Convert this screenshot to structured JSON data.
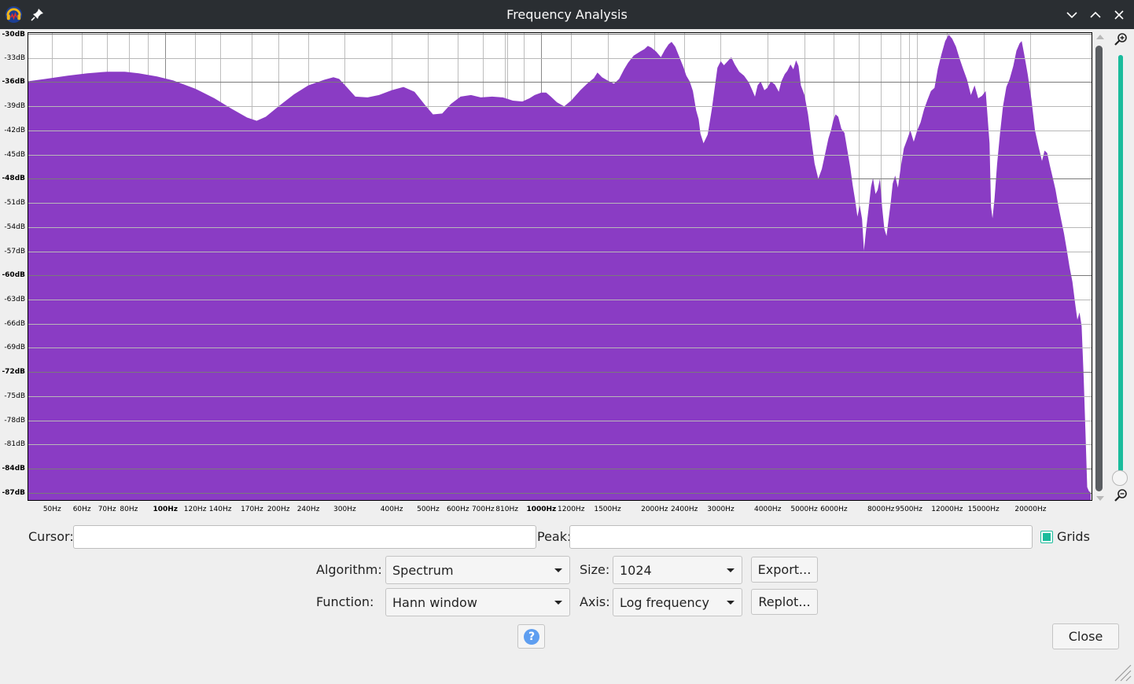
{
  "window": {
    "title": "Frequency Analysis",
    "icons": [
      "audacity-app-icon",
      "pin-icon",
      "minimize-icon",
      "maximize-icon",
      "close-icon"
    ]
  },
  "plot": {
    "fill_color": "#8a3cc4",
    "y_ticks": [
      {
        "label": "-30dB",
        "value": -30,
        "major": true
      },
      {
        "label": "-33dB",
        "value": -33,
        "major": false
      },
      {
        "label": "-36dB",
        "value": -36,
        "major": true
      },
      {
        "label": "-39dB",
        "value": -39,
        "major": false
      },
      {
        "label": "-42dB",
        "value": -42,
        "major": false
      },
      {
        "label": "-45dB",
        "value": -45,
        "major": false
      },
      {
        "label": "-48dB",
        "value": -48,
        "major": true
      },
      {
        "label": "-51dB",
        "value": -51,
        "major": false
      },
      {
        "label": "-54dB",
        "value": -54,
        "major": false
      },
      {
        "label": "-57dB",
        "value": -57,
        "major": false
      },
      {
        "label": "-60dB",
        "value": -60,
        "major": true
      },
      {
        "label": "-63dB",
        "value": -63,
        "major": false
      },
      {
        "label": "-66dB",
        "value": -66,
        "major": false
      },
      {
        "label": "-69dB",
        "value": -69,
        "major": false
      },
      {
        "label": "-72dB",
        "value": -72,
        "major": true
      },
      {
        "label": "-75dB",
        "value": -75,
        "major": false
      },
      {
        "label": "-78dB",
        "value": -78,
        "major": false
      },
      {
        "label": "-81dB",
        "value": -81,
        "major": false
      },
      {
        "label": "-84dB",
        "value": -84,
        "major": true
      },
      {
        "label": "-87dB",
        "value": -87,
        "major": true
      }
    ],
    "x_ticks": [
      {
        "label": "50Hz",
        "value": 50,
        "major": false
      },
      {
        "label": "60Hz",
        "value": 60,
        "major": false
      },
      {
        "label": "70Hz",
        "value": 70,
        "major": false
      },
      {
        "label": "80Hz",
        "value": 80,
        "major": false
      },
      {
        "label": "100Hz",
        "value": 100,
        "major": true
      },
      {
        "label": "120Hz",
        "value": 120,
        "major": false
      },
      {
        "label": "140Hz",
        "value": 140,
        "major": false
      },
      {
        "label": "170Hz",
        "value": 170,
        "major": false
      },
      {
        "label": "200Hz",
        "value": 200,
        "major": false
      },
      {
        "label": "240Hz",
        "value": 240,
        "major": false
      },
      {
        "label": "300Hz",
        "value": 300,
        "major": false
      },
      {
        "label": "400Hz",
        "value": 400,
        "major": false
      },
      {
        "label": "500Hz",
        "value": 500,
        "major": false
      },
      {
        "label": "600Hz",
        "value": 600,
        "major": false
      },
      {
        "label": "700Hz",
        "value": 700,
        "major": false
      },
      {
        "label": "810Hz",
        "value": 810,
        "major": false
      },
      {
        "label": "1000Hz",
        "value": 1000,
        "major": true
      },
      {
        "label": "1200Hz",
        "value": 1200,
        "major": false
      },
      {
        "label": "1500Hz",
        "value": 1500,
        "major": false
      },
      {
        "label": "2000Hz",
        "value": 2000,
        "major": false
      },
      {
        "label": "2400Hz",
        "value": 2400,
        "major": false
      },
      {
        "label": "3000Hz",
        "value": 3000,
        "major": false
      },
      {
        "label": "4000Hz",
        "value": 4000,
        "major": false
      },
      {
        "label": "5000Hz",
        "value": 5000,
        "major": false
      },
      {
        "label": "6000Hz",
        "value": 6000,
        "major": false
      },
      {
        "label": "8000Hz",
        "value": 8000,
        "major": false
      },
      {
        "label": "9500Hz",
        "value": 9500,
        "major": false
      },
      {
        "label": "12000Hz",
        "value": 12000,
        "major": false
      },
      {
        "label": "15000Hz",
        "value": 15000,
        "major": false
      },
      {
        "label": "20000Hz",
        "value": 20000,
        "major": false
      }
    ],
    "spectrum": [
      [
        43,
        -35.9
      ],
      [
        48,
        -35.6
      ],
      [
        55,
        -35.2
      ],
      [
        62,
        -34.9
      ],
      [
        70,
        -34.7
      ],
      [
        78,
        -34.7
      ],
      [
        85,
        -34.9
      ],
      [
        95,
        -35.3
      ],
      [
        105,
        -35.8
      ],
      [
        120,
        -36.8
      ],
      [
        135,
        -38.0
      ],
      [
        150,
        -39.3
      ],
      [
        165,
        -40.4
      ],
      [
        175,
        -40.8
      ],
      [
        185,
        -40.3
      ],
      [
        200,
        -39.0
      ],
      [
        220,
        -37.5
      ],
      [
        240,
        -36.4
      ],
      [
        265,
        -35.7
      ],
      [
        280,
        -35.4
      ],
      [
        290,
        -35.6
      ],
      [
        305,
        -36.7
      ],
      [
        320,
        -37.8
      ],
      [
        345,
        -37.9
      ],
      [
        370,
        -37.6
      ],
      [
        400,
        -37.0
      ],
      [
        430,
        -36.6
      ],
      [
        460,
        -37.2
      ],
      [
        490,
        -38.8
      ],
      [
        515,
        -40.0
      ],
      [
        545,
        -39.9
      ],
      [
        575,
        -38.7
      ],
      [
        610,
        -37.8
      ],
      [
        650,
        -37.6
      ],
      [
        690,
        -37.9
      ],
      [
        740,
        -37.8
      ],
      [
        790,
        -37.9
      ],
      [
        840,
        -38.3
      ],
      [
        890,
        -38.4
      ],
      [
        930,
        -38.0
      ],
      [
        960,
        -37.6
      ],
      [
        1000,
        -37.3
      ],
      [
        1030,
        -37.3
      ],
      [
        1060,
        -37.8
      ],
      [
        1100,
        -38.5
      ],
      [
        1150,
        -39.0
      ],
      [
        1200,
        -38.3
      ],
      [
        1270,
        -37.0
      ],
      [
        1330,
        -36.1
      ],
      [
        1380,
        -35.5
      ],
      [
        1410,
        -34.8
      ],
      [
        1450,
        -35.4
      ],
      [
        1500,
        -35.8
      ],
      [
        1560,
        -36.2
      ],
      [
        1610,
        -35.6
      ],
      [
        1660,
        -34.4
      ],
      [
        1700,
        -33.6
      ],
      [
        1760,
        -32.7
      ],
      [
        1830,
        -32.2
      ],
      [
        1880,
        -31.9
      ],
      [
        1920,
        -31.5
      ],
      [
        1960,
        -31.7
      ],
      [
        2020,
        -32.2
      ],
      [
        2080,
        -32.9
      ],
      [
        2130,
        -32.0
      ],
      [
        2180,
        -31.3
      ],
      [
        2220,
        -31.0
      ],
      [
        2270,
        -31.6
      ],
      [
        2330,
        -32.9
      ],
      [
        2390,
        -34.2
      ],
      [
        2430,
        -35.2
      ],
      [
        2480,
        -35.9
      ],
      [
        2530,
        -37.1
      ],
      [
        2580,
        -39.5
      ],
      [
        2620,
        -40.6
      ],
      [
        2650,
        -42.4
      ],
      [
        2700,
        -43.6
      ],
      [
        2770,
        -42.5
      ],
      [
        2840,
        -39.4
      ],
      [
        2890,
        -36.8
      ],
      [
        2940,
        -34.2
      ],
      [
        3000,
        -33.4
      ],
      [
        3060,
        -33.9
      ],
      [
        3130,
        -33.4
      ],
      [
        3200,
        -32.9
      ],
      [
        3270,
        -33.8
      ],
      [
        3360,
        -34.7
      ],
      [
        3460,
        -35.2
      ],
      [
        3560,
        -36.0
      ],
      [
        3640,
        -37.0
      ],
      [
        3700,
        -37.8
      ],
      [
        3760,
        -36.4
      ],
      [
        3830,
        -35.9
      ],
      [
        3920,
        -37.0
      ],
      [
        3990,
        -36.7
      ],
      [
        4080,
        -35.9
      ],
      [
        4180,
        -36.3
      ],
      [
        4280,
        -37.2
      ],
      [
        4350,
        -35.9
      ],
      [
        4440,
        -35.0
      ],
      [
        4510,
        -34.6
      ],
      [
        4600,
        -33.8
      ],
      [
        4680,
        -34.4
      ],
      [
        4760,
        -33.3
      ],
      [
        4830,
        -34.0
      ],
      [
        4900,
        -36.4
      ],
      [
        5010,
        -37.6
      ],
      [
        5120,
        -40.0
      ],
      [
        5230,
        -43.3
      ],
      [
        5330,
        -46.1
      ],
      [
        5450,
        -48.0
      ],
      [
        5570,
        -46.8
      ],
      [
        5680,
        -45.0
      ],
      [
        5800,
        -43.0
      ],
      [
        5900,
        -41.9
      ],
      [
        5980,
        -40.7
      ],
      [
        6060,
        -40.0
      ],
      [
        6160,
        -40.3
      ],
      [
        6280,
        -41.8
      ],
      [
        6400,
        -42.3
      ],
      [
        6510,
        -44.4
      ],
      [
        6630,
        -46.6
      ],
      [
        6730,
        -48.8
      ],
      [
        6830,
        -50.6
      ],
      [
        6930,
        -52.7
      ],
      [
        7030,
        -51.3
      ],
      [
        7130,
        -53.0
      ],
      [
        7210,
        -56.9
      ],
      [
        7320,
        -54.0
      ],
      [
        7420,
        -51.7
      ],
      [
        7530,
        -49.0
      ],
      [
        7620,
        -47.9
      ],
      [
        7740,
        -49.9
      ],
      [
        7840,
        -49.4
      ],
      [
        7950,
        -48.0
      ],
      [
        8060,
        -51.5
      ],
      [
        8170,
        -54.2
      ],
      [
        8280,
        -55.1
      ],
      [
        8390,
        -53.0
      ],
      [
        8500,
        -50.9
      ],
      [
        8600,
        -48.6
      ],
      [
        8730,
        -47.6
      ],
      [
        8880,
        -49.1
      ],
      [
        9040,
        -46.5
      ],
      [
        9210,
        -44.2
      ],
      [
        9400,
        -43.1
      ],
      [
        9580,
        -42.0
      ],
      [
        9780,
        -43.4
      ],
      [
        9990,
        -42.0
      ],
      [
        10200,
        -41.0
      ],
      [
        10420,
        -39.4
      ],
      [
        10640,
        -38.2
      ],
      [
        10870,
        -37.1
      ],
      [
        11110,
        -36.7
      ],
      [
        11340,
        -34.3
      ],
      [
        11600,
        -32.5
      ],
      [
        11860,
        -30.9
      ],
      [
        12120,
        -30.1
      ],
      [
        12380,
        -30.6
      ],
      [
        12670,
        -31.6
      ],
      [
        12960,
        -33.1
      ],
      [
        13250,
        -34.4
      ],
      [
        13560,
        -35.7
      ],
      [
        13880,
        -37.6
      ],
      [
        14200,
        -36.4
      ],
      [
        14520,
        -38.0
      ],
      [
        14860,
        -37.7
      ],
      [
        15200,
        -37.1
      ],
      [
        15560,
        -43.6
      ],
      [
        15700,
        -51.5
      ],
      [
        15850,
        -52.9
      ],
      [
        16050,
        -50.4
      ],
      [
        16300,
        -46.2
      ],
      [
        16600,
        -42.3
      ],
      [
        16900,
        -39.0
      ],
      [
        17250,
        -36.6
      ],
      [
        17600,
        -35.6
      ],
      [
        18000,
        -34.0
      ],
      [
        18350,
        -32.1
      ],
      [
        18700,
        -31.2
      ],
      [
        18950,
        -30.9
      ],
      [
        19250,
        -32.6
      ],
      [
        19650,
        -35.0
      ],
      [
        20100,
        -38.1
      ],
      [
        20550,
        -42.0
      ],
      [
        21000,
        -44.0
      ],
      [
        21450,
        -45.8
      ],
      [
        21800,
        -44.5
      ],
      [
        22150,
        -44.8
      ],
      [
        22500,
        -46.3
      ],
      [
        22900,
        -47.8
      ],
      [
        23300,
        -49.3
      ],
      [
        23700,
        -51.3
      ],
      [
        24150,
        -53.2
      ],
      [
        24550,
        -54.8
      ],
      [
        24950,
        -56.7
      ],
      [
        25400,
        -59.0
      ],
      [
        25850,
        -60.8
      ],
      [
        26300,
        -63.6
      ],
      [
        26650,
        -65.5
      ],
      [
        27000,
        -64.6
      ],
      [
        27350,
        -66.3
      ],
      [
        27700,
        -72.7
      ],
      [
        28000,
        -79.5
      ],
      [
        28300,
        -86.3
      ],
      [
        28600,
        -86.8
      ],
      [
        28900,
        -87.0
      ]
    ]
  },
  "controls": {
    "cursor_label": "Cursor:",
    "cursor_value": "",
    "peak_label": "Peak:",
    "peak_value": "",
    "grids_label": "Grids",
    "grids_checked": true,
    "algorithm_label": "Algorithm:",
    "algorithm_value": "Spectrum",
    "size_label": "Size:",
    "size_value": "1024",
    "function_label": "Function:",
    "function_value": "Hann window",
    "axis_label": "Axis:",
    "axis_value": "Log frequency",
    "export_label": "Export...",
    "replot_label": "Replot...",
    "help_glyph": "?",
    "close_label": "Close"
  }
}
